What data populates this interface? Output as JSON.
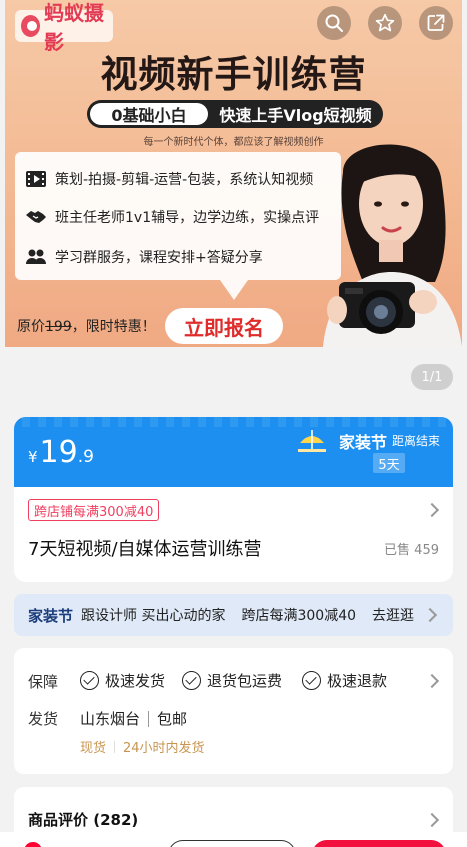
{
  "banner": {
    "logo_text": "蚂蚁摄影",
    "title": "视频新手训练营",
    "pill_left": "0基础小白",
    "pill_right": "快速上手Vlog短视频",
    "subtitle": "每一个新时代个体，都应该了解视频创作",
    "features": [
      {
        "icon": "film-icon",
        "text": "策划-拍摄-剪辑-运营-包装，系统认知视频"
      },
      {
        "icon": "handshake-icon",
        "text": "班主任老师1v1辅导，边学边练，实操点评"
      },
      {
        "icon": "group-icon",
        "text": "学习群服务，课程安排+答疑分享"
      }
    ],
    "price_prefix": "原价",
    "original_price": "199",
    "price_suffix": "，限时特惠！",
    "cta": "立即报名"
  },
  "pager": "1/1",
  "price_card": {
    "currency": "¥",
    "price_int": "19",
    "price_dec": ".9",
    "festival": "家装节",
    "ends_label": "距离结束",
    "countdown": "5天"
  },
  "product": {
    "promo_tag": "跨店铺每满300减40",
    "title": "7天短视频/自媒体运营训练营",
    "sold": "已售 459"
  },
  "strip": {
    "festival": "家装节",
    "text1": "跟设计师 买出心动的家",
    "text2": "跨店每满300减40",
    "link": "去逛逛"
  },
  "guarantee": {
    "label": "保障",
    "items": [
      "极速发货",
      "退货包运费",
      "极速退款"
    ],
    "ship_label": "发货",
    "location": "山东烟台",
    "free_ship": "包邮",
    "stock": "现货",
    "dispatch": "24小时内发货"
  },
  "reviews": {
    "title": "商品评价 (282)"
  },
  "colors": {
    "accent_blue": "#1c8ff0",
    "promo_red": "#f04060",
    "cta_red": "#f2103e",
    "ship_gold": "#c89550"
  }
}
